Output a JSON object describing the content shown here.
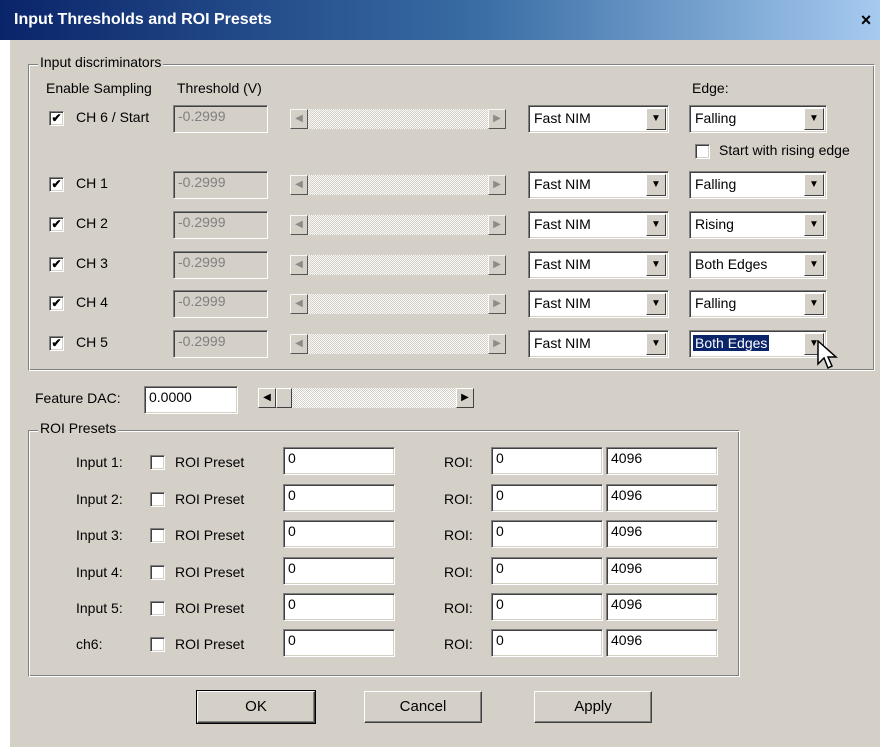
{
  "window": {
    "title": "Input Thresholds and ROI Presets",
    "close_glyph": "×"
  },
  "discriminators": {
    "group_title": "Input discriminators",
    "headers": {
      "enable": "Enable Sampling",
      "threshold": "Threshold (V)",
      "edge": "Edge:"
    },
    "rising_edge_checkbox": {
      "label": "Start with rising edge",
      "checked": false
    },
    "channels": [
      {
        "label": "CH 6 / Start",
        "checked": true,
        "threshold": "-0.2999",
        "standard": "Fast NIM",
        "edge": "Falling"
      },
      {
        "label": "CH 1",
        "checked": true,
        "threshold": "-0.2999",
        "standard": "Fast NIM",
        "edge": "Falling"
      },
      {
        "label": "CH 2",
        "checked": true,
        "threshold": "-0.2999",
        "standard": "Fast NIM",
        "edge": "Rising"
      },
      {
        "label": "CH 3",
        "checked": true,
        "threshold": "-0.2999",
        "standard": "Fast NIM",
        "edge": "Both Edges"
      },
      {
        "label": "CH 4",
        "checked": true,
        "threshold": "-0.2999",
        "standard": "Fast NIM",
        "edge": "Falling"
      },
      {
        "label": "CH 5",
        "checked": true,
        "threshold": "-0.2999",
        "standard": "Fast NIM",
        "edge": "Both Edges"
      }
    ]
  },
  "feature_dac": {
    "label": "Feature DAC:",
    "value": "0.0000"
  },
  "roi": {
    "group_title": "ROI Presets",
    "rows": [
      {
        "input_label": "Input 1:",
        "preset_label": "ROI Preset",
        "checked": false,
        "preset_value": "0",
        "roi_label": "ROI:",
        "roi_start": "0",
        "roi_end": "4096"
      },
      {
        "input_label": "Input 2:",
        "preset_label": "ROI Preset",
        "checked": false,
        "preset_value": "0",
        "roi_label": "ROI:",
        "roi_start": "0",
        "roi_end": "4096"
      },
      {
        "input_label": "Input 3:",
        "preset_label": "ROI Preset",
        "checked": false,
        "preset_value": "0",
        "roi_label": "ROI:",
        "roi_start": "0",
        "roi_end": "4096"
      },
      {
        "input_label": "Input 4:",
        "preset_label": "ROI Preset",
        "checked": false,
        "preset_value": "0",
        "roi_label": "ROI:",
        "roi_start": "0",
        "roi_end": "4096"
      },
      {
        "input_label": "Input 5:",
        "preset_label": "ROI Preset",
        "checked": false,
        "preset_value": "0",
        "roi_label": "ROI:",
        "roi_start": "0",
        "roi_end": "4096"
      },
      {
        "input_label": "ch6:",
        "preset_label": "ROI Preset",
        "checked": false,
        "preset_value": "0",
        "roi_label": "ROI:",
        "roi_start": "0",
        "roi_end": "4096"
      }
    ]
  },
  "buttons": {
    "ok": "OK",
    "cancel": "Cancel",
    "apply": "Apply"
  },
  "colors": {
    "title_bar": "#0a246a",
    "face": "#d4d0c8",
    "selection": "#0a246a"
  },
  "glyphs": {
    "check": "✔",
    "arrow_left": "◀",
    "arrow_right": "▶",
    "arrow_down": "▼"
  }
}
